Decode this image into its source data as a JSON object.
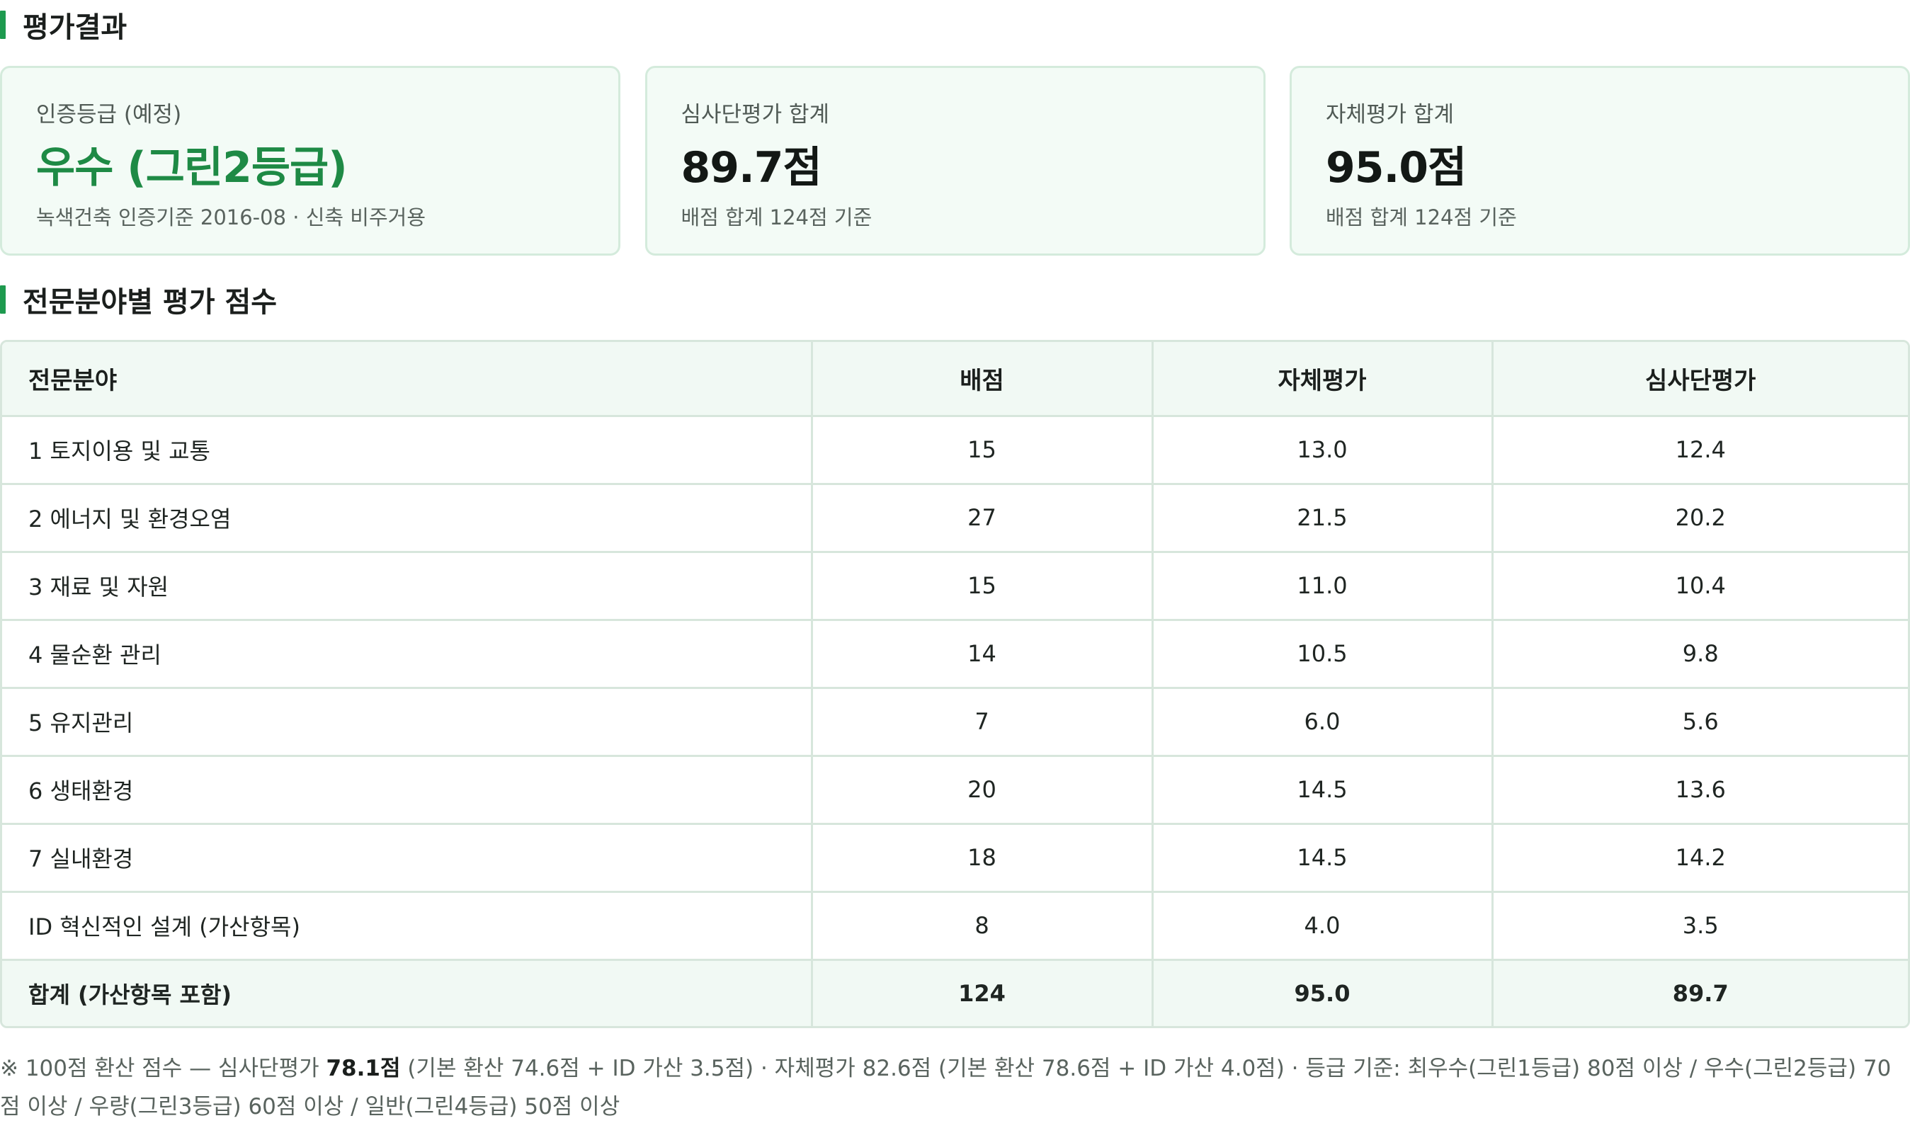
{
  "result_section": {
    "title": "평가결과"
  },
  "summary_cards": [
    {
      "label": "인증등급 (예정)",
      "value": "우수 (그린2등급)",
      "note": "녹색건축 인증기준 2016-08 · 신축 비주거용"
    },
    {
      "label": "심사단평가 합계",
      "value": "89.7점",
      "note": "배점 합계 124점 기준"
    },
    {
      "label": "자체평가 합계",
      "value": "95.0점",
      "note": "배점 합계 124점 기준"
    }
  ],
  "score_section": {
    "title": "전문분야별 평가 점수"
  },
  "score_table": {
    "headers": [
      "전문분야",
      "배점",
      "자체평가",
      "심사단평가"
    ],
    "rows": [
      [
        "1 토지이용 및 교통",
        "15",
        "13.0",
        "12.4"
      ],
      [
        "2 에너지 및 환경오염",
        "27",
        "21.5",
        "20.2"
      ],
      [
        "3 재료 및 자원",
        "15",
        "11.0",
        "10.4"
      ],
      [
        "4 물순환 관리",
        "14",
        "10.5",
        "9.8"
      ],
      [
        "5 유지관리",
        "7",
        "6.0",
        "5.6"
      ],
      [
        "6 생태환경",
        "20",
        "14.5",
        "13.6"
      ],
      [
        "7 실내환경",
        "18",
        "14.5",
        "14.2"
      ],
      [
        "ID 혁신적인 설계 (가산항목)",
        "8",
        "4.0",
        "3.5"
      ]
    ],
    "total": [
      "합계 (가산항목 포함)",
      "124",
      "95.0",
      "89.7"
    ]
  },
  "footnote": {
    "prefix": "※ 100점 환산 점수 — 심사단평가 ",
    "highlight": "78.1점",
    "suffix": " (기본 환산 74.6점 + ID 가산 3.5점) · 자체평가 82.6점 (기본 환산 78.6점 + ID 가산 4.0점) · 등급 기준: 최우수(그린1등급) 80점 이상 / 우수(그린2등급) 70점 이상 / 우량(그린3등급) 60점 이상 / 일반(그린4등급) 50점 이상"
  },
  "colors": {
    "accent": "#1e9a4f",
    "grade_text": "#1e8a45",
    "card_bg": "#f3fbf6",
    "border": "#d7e6dc"
  }
}
